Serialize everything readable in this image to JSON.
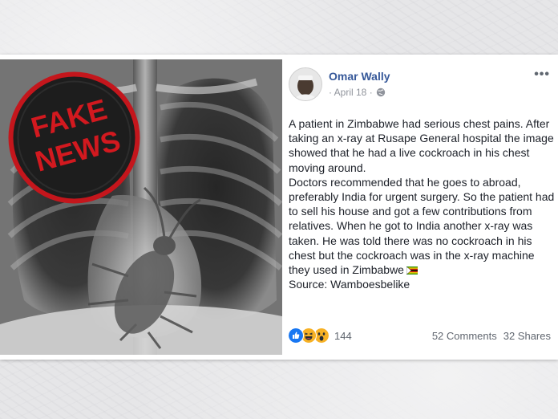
{
  "stamp": {
    "line1": "FAKE",
    "line2": "NEWS"
  },
  "post": {
    "author": "Omar Wally",
    "date": "· April 18 ·",
    "privacy_icon": "globe-icon",
    "more_icon": "•••",
    "paragraphs": [
      "A patient in Zimbabwe had serious chest pains. After taking an x-ray at Rusape General hospital the image showed that he had a live cockroach in his chest moving around.",
      "Doctors recommended that he goes to abroad, preferably India for urgent surgery. So the patient had to sell his house and got a few contributions from relatives. When he got to India another x-ray was taken. He was told there was no cockroach in his chest but the cockroach was in the x-ray machine they used in Zimbabwe",
      "Source: Wamboesbelike"
    ],
    "flag_icon": "zimbabwe-flag-icon",
    "reactions": {
      "icons": [
        "like-icon",
        "haha-icon",
        "wow-icon"
      ],
      "count": "144"
    },
    "comments": "52 Comments",
    "shares": "32 Shares"
  },
  "colors": {
    "link": "#365899",
    "stamp_red": "#c4161c",
    "meta": "#90949c"
  }
}
